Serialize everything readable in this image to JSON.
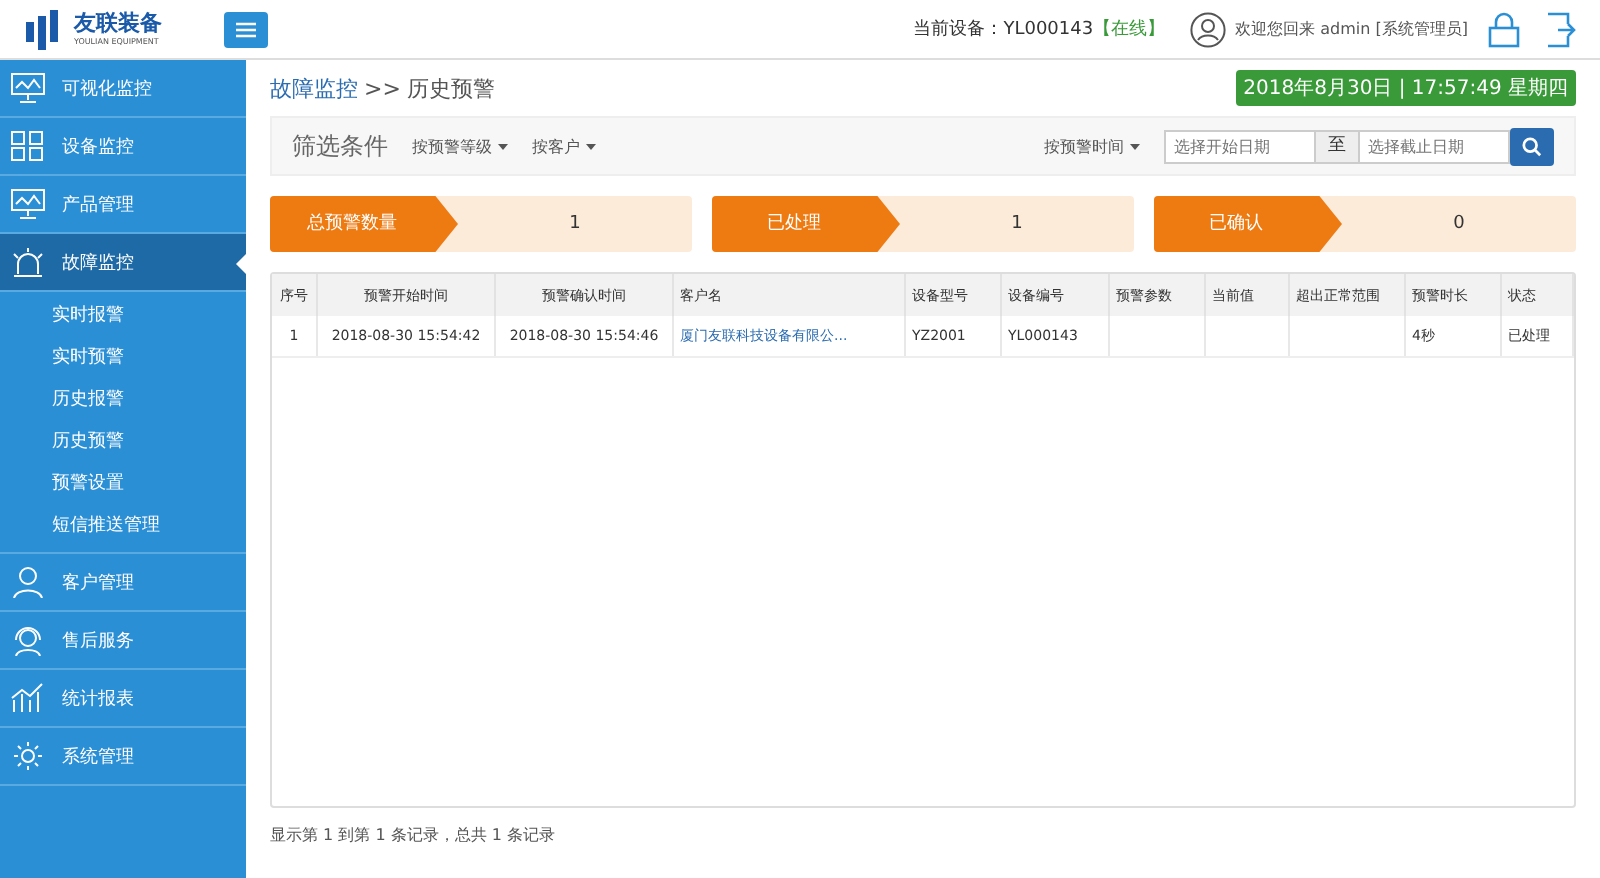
{
  "header": {
    "logo_text": "友联装备",
    "logo_subtext": "YOULIAN EQUIPMENT",
    "device_label": "当前设备：YL000143",
    "device_status": "【在线】",
    "welcome": "欢迎您回来 admin [系统管理员]"
  },
  "sidebar": {
    "items": [
      {
        "label": "可视化监控",
        "selected": false
      },
      {
        "label": "设备监控",
        "selected": false
      },
      {
        "label": "产品管理",
        "selected": false
      },
      {
        "label": "故障监控",
        "selected": true,
        "children": [
          {
            "label": "实时报警",
            "selected": false
          },
          {
            "label": "实时预警",
            "selected": false
          },
          {
            "label": "历史报警",
            "selected": false
          },
          {
            "label": "历史预警",
            "selected": false
          },
          {
            "label": "预警设置",
            "selected": false
          },
          {
            "label": "短信推送管理",
            "selected": false
          }
        ]
      },
      {
        "label": "客户管理",
        "selected": false
      },
      {
        "label": "售后服务",
        "selected": false
      },
      {
        "label": "统计报表",
        "selected": false
      },
      {
        "label": "系统管理",
        "selected": false
      }
    ]
  },
  "breadcrumb": {
    "parent": "故障监控",
    "separator": ">>",
    "current": "历史预警"
  },
  "datetime": "2018年8月30日 | 17:57:49 星期四",
  "filter": {
    "title": "筛选条件",
    "dropdowns": [
      "按预警等级",
      "按客户"
    ],
    "time_dropdown": "按预警时间",
    "start_placeholder": "选择开始日期",
    "to": "至",
    "end_placeholder": "选择截止日期"
  },
  "stats": [
    {
      "label": "总预警数量",
      "value": "1"
    },
    {
      "label": "已处理",
      "value": "1"
    },
    {
      "label": "已确认",
      "value": "0"
    }
  ],
  "table": {
    "columns": [
      "序号",
      "预警开始时间",
      "预警确认时间",
      "客户名",
      "设备型号",
      "设备编号",
      "预警参数",
      "当前值",
      "超出正常范围",
      "预警时长",
      "状态"
    ],
    "rows": [
      {
        "cells": [
          "1",
          "2018-08-30 15:54:42",
          "2018-08-30 15:54:46",
          "厦门友联科技设备有限公...",
          "YZ2001",
          "YL000143",
          null,
          null,
          null,
          "4秒",
          "已处理"
        ]
      }
    ]
  },
  "pagination": "显示第 1 到第 1 条记录，总共 1 条记录"
}
